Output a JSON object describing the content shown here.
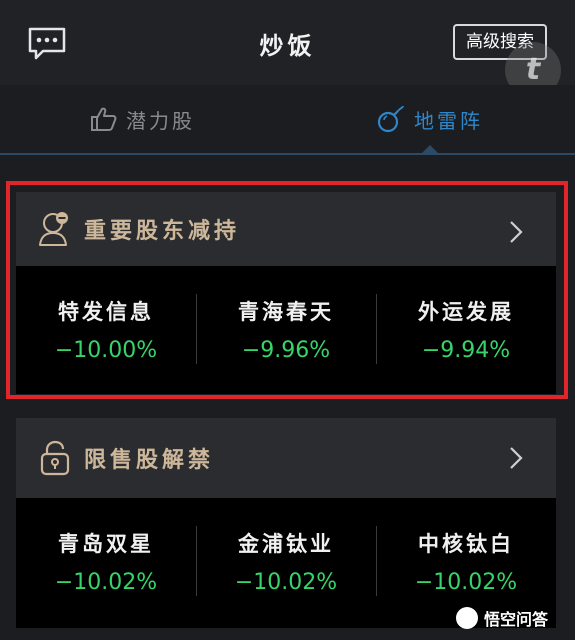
{
  "header": {
    "title": "炒饭",
    "advanced_search_label": "高级搜索",
    "message_icon": "chat-bubble-icon"
  },
  "tabs": [
    {
      "label": "潜力股",
      "icon": "thumbs-up-icon",
      "active": false
    },
    {
      "label": "地雷阵",
      "icon": "bomb-icon",
      "active": true
    }
  ],
  "sections": [
    {
      "title": "重要股东减持",
      "icon": "person-minus-icon",
      "stocks": [
        {
          "name": "特发信息",
          "change": "−10.00%"
        },
        {
          "name": "青海春天",
          "change": "−9.96%"
        },
        {
          "name": "外运发展",
          "change": "−9.94%"
        }
      ]
    },
    {
      "title": "限售股解禁",
      "icon": "unlock-icon",
      "stocks": [
        {
          "name": "青岛双星",
          "change": "−10.02%"
        },
        {
          "name": "金浦钛业",
          "change": "−10.02%"
        },
        {
          "name": "中核钛白",
          "change": "−10.02%"
        }
      ]
    }
  ],
  "watermark": "悟空问答",
  "colors": {
    "accent_blue": "#2f86c9",
    "gain_green": "#36d46a",
    "section_title": "#cdb79a",
    "highlight_red": "#e0262b"
  }
}
